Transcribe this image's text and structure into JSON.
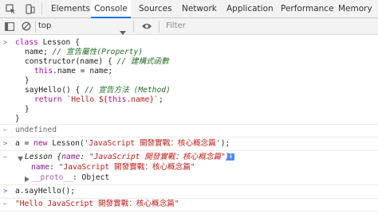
{
  "tabs": [
    {
      "label": "Elements",
      "active": false
    },
    {
      "label": "Console",
      "active": true
    },
    {
      "label": "Sources",
      "active": false
    },
    {
      "label": "Network",
      "active": false
    },
    {
      "label": "Application",
      "active": false
    },
    {
      "label": "Performance",
      "active": false
    },
    {
      "label": "Memory",
      "active": false
    }
  ],
  "toolbar": {
    "context": "top",
    "filter_placeholder": "Filter"
  },
  "console": {
    "input1": {
      "l1_a": "class ",
      "l1_b": "Lesson",
      "l1_c": " {",
      "l2_a": "name; ",
      "l2_b": "// 宣告屬性(Property)",
      "l3_a": "constructor(name) { ",
      "l3_b": "// 建構式函數",
      "l4_a": "this",
      "l4_b": ".name = name;",
      "l5": "}",
      "l6_a": "sayHello() { ",
      "l6_b": "// 宣告方法 (Method)",
      "l7_a": "return ",
      "l7_b": "`Hello ${",
      "l7_c": "this",
      "l7_d": ".name}`",
      "l7_e": ";",
      "l8": "}",
      "l9": "}"
    },
    "output1": "undefined",
    "input2": {
      "a": "a = ",
      "b": "new",
      "c": " Lesson(",
      "d": "'JavaScript 開發實戰：核心概念篇'",
      "e": ");"
    },
    "output2": {
      "class_name": "Lesson",
      "preview_open": " {",
      "preview_key": "name",
      "preview_sep": ": ",
      "preview_value": "\"JavaScript 開發實戰：核心概念篇\"",
      "preview_close": "}",
      "badge": "i",
      "prop_key": "name",
      "prop_sep": ": ",
      "prop_value": "\"JavaScript 開發實戰：核心概念篇\"",
      "proto_key": "__proto__",
      "proto_sep": ": ",
      "proto_value": "Object"
    },
    "input3": "a.sayHello();",
    "output3": "\"Hello JavaScript 開發實戰：核心概念篇\""
  }
}
